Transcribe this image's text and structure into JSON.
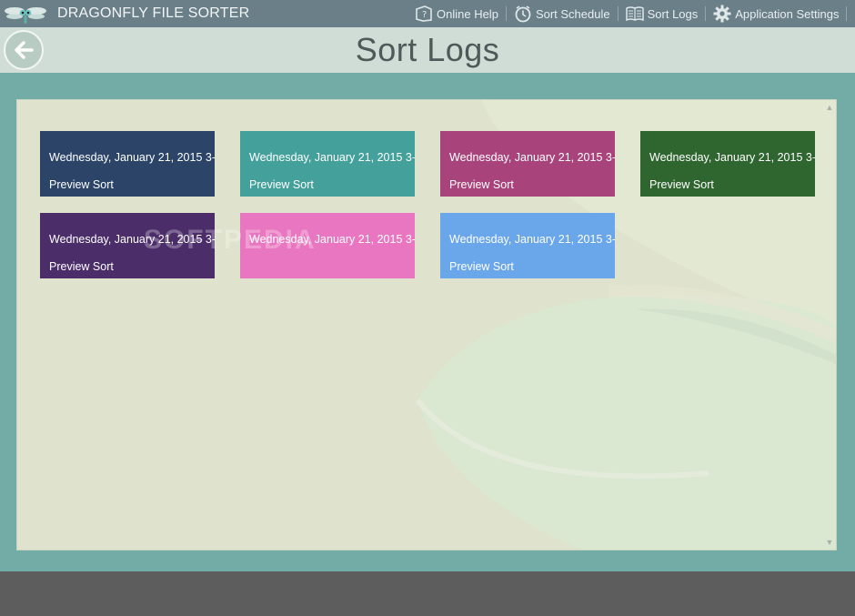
{
  "app": {
    "title": "DRAGONFLY FILE SORTER"
  },
  "menu": {
    "online_help": "Online Help",
    "sort_schedule": "Sort Schedule",
    "sort_logs": "Sort Logs",
    "app_settings": "Application Settings",
    "close": "✕"
  },
  "header": {
    "title": "Sort Logs"
  },
  "logs": [
    {
      "line1": "Wednesday, January 21, 2015 3-",
      "line2": "Preview Sort",
      "color": "#2b4468"
    },
    {
      "line1": "Wednesday, January 21, 2015 3-",
      "line2": "Preview Sort",
      "color": "#44a09b"
    },
    {
      "line1": "Wednesday, January 21, 2015 3-",
      "line2": "Preview Sort",
      "color": "#a8447b"
    },
    {
      "line1": "Wednesday, January 21, 2015 3-",
      "line2": "Preview Sort",
      "color": "#2f6630"
    },
    {
      "line1": "Wednesday, January 21, 2015 3-",
      "line2": "Preview Sort",
      "color": "#4b2d6a"
    },
    {
      "line1": "Wednesday, January 21, 2015 3-",
      "line2": "",
      "color": "#e976c0"
    },
    {
      "line1": "Wednesday, January 21, 2015 3-",
      "line2": "Preview Sort",
      "color": "#6aa6ea"
    }
  ],
  "watermark": "SOFTPEDIA",
  "colors": {
    "titlebar": "#6b7f88",
    "header": "#cfddd6",
    "outer": "#73aca6",
    "panel": "#dfe2cc"
  }
}
